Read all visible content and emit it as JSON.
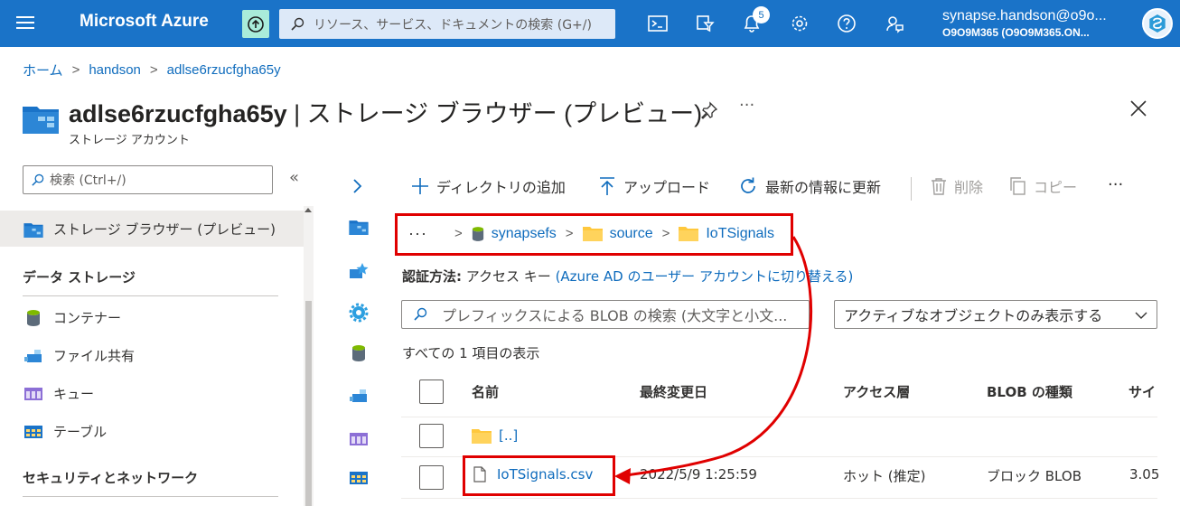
{
  "topbar": {
    "brand": "Microsoft Azure",
    "search_placeholder": "リソース、サービス、ドキュメントの検索 (G+/)",
    "notification_count": "5",
    "user_email": "synapse.handson@o9o...",
    "user_tenant": "O9O9M365 (O9O9M365.ON..."
  },
  "breadcrumb": {
    "home": "ホーム",
    "sep1": ">",
    "handson": "handson",
    "sep2": ">",
    "account": "adlse6rzucfgha65y"
  },
  "header": {
    "title_bold": "adlse6rzucfgha65y",
    "title_rest": " | ストレージ ブラウザー (プレビュー)",
    "subtitle": "ストレージ アカウント",
    "more": "···"
  },
  "nav": {
    "search_placeholder": "検索 (Ctrl+/)",
    "collapse": "«",
    "selected_item": "ストレージ ブラウザー (プレビュー)",
    "section1_heading": "データ ストレージ",
    "items": [
      {
        "label": "コンテナー",
        "icon": "container-icon"
      },
      {
        "label": "ファイル共有",
        "icon": "file-share-icon"
      },
      {
        "label": "キュー",
        "icon": "queue-icon"
      },
      {
        "label": "テーブル",
        "icon": "table-icon"
      }
    ],
    "section2_heading": "セキュリティとネットワーク"
  },
  "commands": {
    "add_directory": "ディレクトリの追加",
    "upload": "アップロード",
    "refresh": "最新の情報に更新",
    "delete": "削除",
    "copy": "コピー",
    "more": "···"
  },
  "path": {
    "dots": "···",
    "container": "synapsefs",
    "folder1": "source",
    "folder2": "IoTSignals"
  },
  "auth": {
    "label": "認証方法:",
    "value": " アクセス キー ",
    "switch_link": "(Azure AD のユーザー アカウントに切り替える)"
  },
  "filters": {
    "search_placeholder": "プレフィックスによる BLOB の検索 (大文字と小文...",
    "active_filter": "アクティブなオブジェクトのみ表示する"
  },
  "list": {
    "count_text": "すべての 1 項目の表示",
    "columns": [
      "名前",
      "最終変更日",
      "アクセス層",
      "BLOB の種類",
      "サイ"
    ],
    "rows": [
      {
        "name": "[..]",
        "modified": "",
        "tier": "",
        "type": "",
        "size": ""
      },
      {
        "name": "IoTSignals.csv",
        "modified": "2022/5/9 1:25:59",
        "tier": "ホット (推定)",
        "type": "ブロック BLOB",
        "size": "3.05"
      }
    ]
  },
  "colors": {
    "topbar": "#1a73c8",
    "link": "#0f6cbd",
    "annotation": "#e00000",
    "folder": "#ffc83d"
  }
}
